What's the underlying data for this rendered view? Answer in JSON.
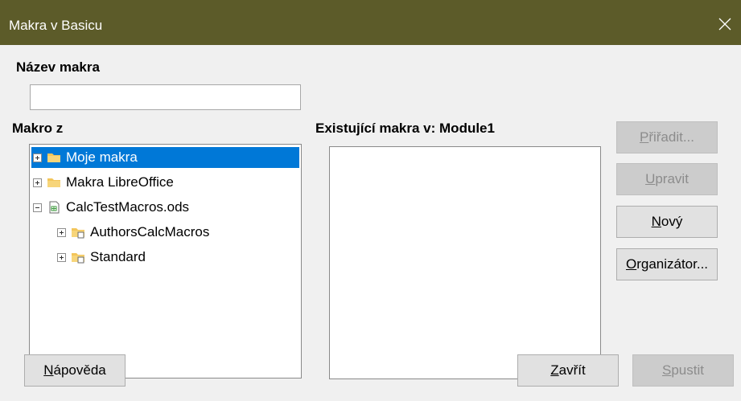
{
  "window": {
    "title": "Makra v Basicu",
    "close_icon": "close-icon"
  },
  "macro_name": {
    "label": "Název makra",
    "value": ""
  },
  "macro_from": {
    "label": "Makro z",
    "tree": [
      {
        "label": "Moje makra",
        "expander": "plus",
        "icon": "folder-icon",
        "selected": true
      },
      {
        "label": "Makra LibreOffice",
        "expander": "plus",
        "icon": "folder-icon",
        "selected": false
      },
      {
        "label": "CalcTestMacros.ods",
        "expander": "minus",
        "icon": "spreadsheet-document-icon",
        "selected": false
      },
      {
        "label": "AuthorsCalcMacros",
        "expander": "plus",
        "icon": "library-folder-icon",
        "selected": false
      },
      {
        "label": "Standard",
        "expander": "plus",
        "icon": "library-folder-icon",
        "selected": false
      }
    ]
  },
  "existing": {
    "label": "Existující makra v: Module1",
    "items": []
  },
  "buttons": {
    "assign": {
      "mnemonic": "P",
      "rest": "řiřadit...",
      "enabled": false
    },
    "edit": {
      "mnemonic": "U",
      "rest": "pravit",
      "enabled": false
    },
    "new": {
      "mnemonic": "N",
      "rest": "ový",
      "enabled": true
    },
    "organizer": {
      "mnemonic": "O",
      "rest": "rganizátor...",
      "enabled": true
    },
    "help": {
      "mnemonic": "N",
      "rest": "ápověda",
      "enabled": true
    },
    "close": {
      "mnemonic": "Z",
      "rest": "avřít",
      "enabled": true
    },
    "run": {
      "mnemonic": "S",
      "rest": "pustit",
      "enabled": false
    }
  },
  "colors": {
    "titlebar": "#5c5b29",
    "selection": "#0078d7",
    "folder": "#f3c55a"
  }
}
